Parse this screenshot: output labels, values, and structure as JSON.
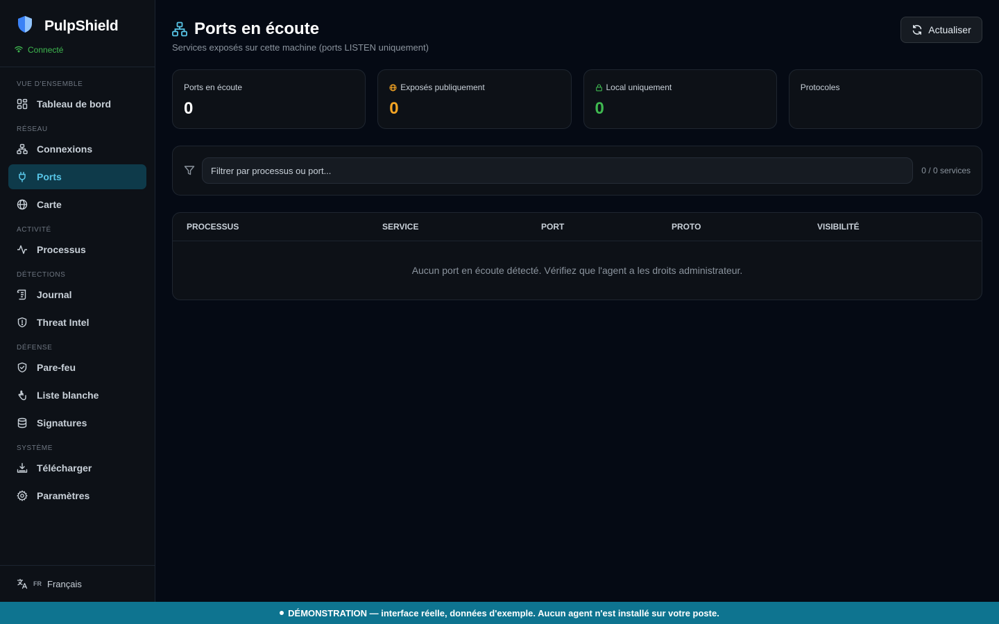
{
  "app": {
    "name": "PulpShield",
    "status": "Connecté"
  },
  "sidebar": {
    "sections": [
      {
        "title": "VUE D'ENSEMBLE",
        "items": [
          {
            "label": "Tableau de bord",
            "icon": "dashboard-icon"
          }
        ]
      },
      {
        "title": "RÉSEAU",
        "items": [
          {
            "label": "Connexions",
            "icon": "network-icon"
          },
          {
            "label": "Ports",
            "icon": "plug-icon",
            "active": true
          },
          {
            "label": "Carte",
            "icon": "globe-icon"
          }
        ]
      },
      {
        "title": "ACTIVITÉ",
        "items": [
          {
            "label": "Processus",
            "icon": "activity-icon"
          }
        ]
      },
      {
        "title": "DÉTECTIONS",
        "items": [
          {
            "label": "Journal",
            "icon": "scroll-icon"
          },
          {
            "label": "Threat Intel",
            "icon": "shield-alert-icon"
          }
        ]
      },
      {
        "title": "DÉFENSE",
        "items": [
          {
            "label": "Pare-feu",
            "icon": "shield-check-icon"
          },
          {
            "label": "Liste blanche",
            "icon": "hand-icon"
          },
          {
            "label": "Signatures",
            "icon": "database-icon"
          }
        ]
      },
      {
        "title": "SYSTÈME",
        "items": [
          {
            "label": "Télécharger",
            "icon": "download-icon"
          },
          {
            "label": "Paramètres",
            "icon": "settings-icon"
          }
        ]
      }
    ],
    "language": {
      "code": "FR",
      "name": "Français"
    }
  },
  "header": {
    "title": "Ports en écoute",
    "subtitle": "Services exposés sur cette machine (ports LISTEN uniquement)",
    "refresh_label": "Actualiser"
  },
  "stats": [
    {
      "label": "Ports en écoute",
      "value": "0",
      "color": "#ffffff",
      "icon": ""
    },
    {
      "label": "Exposés publiquement",
      "value": "0",
      "color": "#f5a524",
      "icon": "globe-icon"
    },
    {
      "label": "Local uniquement",
      "value": "0",
      "color": "#3fb950",
      "icon": "lock-icon"
    },
    {
      "label": "Protocoles",
      "value": "",
      "color": "#ffffff",
      "icon": ""
    }
  ],
  "filter": {
    "placeholder": "Filtrer par processus ou port...",
    "count": "0 / 0 services"
  },
  "table": {
    "columns": [
      "PROCESSUS",
      "SERVICE",
      "PORT",
      "PROTO",
      "VISIBILITÉ"
    ],
    "empty_message": "Aucun port en écoute détecté. Vérifiez que l'agent a les droits administrateur."
  },
  "banner": {
    "text": "DÉMONSTRATION — interface réelle, données d'exemple. Aucun agent n'est installé sur votre poste."
  },
  "colors": {
    "accent": "#58c6e8",
    "active_bg": "#0e3a4a",
    "banner": "#0e7490",
    "success": "#3fb950",
    "warning": "#f5a524"
  }
}
